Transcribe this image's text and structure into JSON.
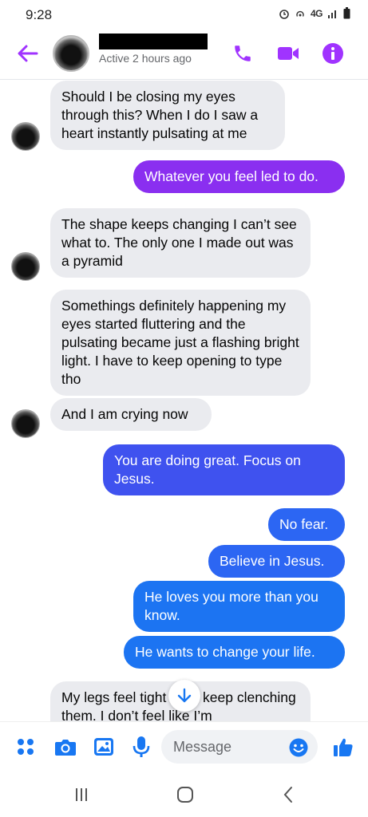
{
  "status_bar": {
    "time": "9:28",
    "network": "4G"
  },
  "header": {
    "contact_status": "Active 2 hours ago"
  },
  "messages": [
    {
      "text": "Should I be closing my eyes through this? When I do I saw a heart instantly pulsating at me"
    },
    {
      "text": "Whatever you feel led to do."
    },
    {
      "text": "The shape keeps changing I can’t see what to. The only one I made out was a pyramid"
    },
    {
      "text": "Somethings definitely happening my eyes started fluttering and the pulsating became just a flashing bright light. I have to keep opening to type tho"
    },
    {
      "text": "And I am crying now"
    },
    {
      "text": "You are doing great.  Focus on Jesus."
    },
    {
      "text": "No fear."
    },
    {
      "text": "Believe in Jesus."
    },
    {
      "text": "He loves you more than you know."
    },
    {
      "text": "He wants to change your life."
    },
    {
      "text": "My legs feel tight like I keep clenching them. I don’t feel like I’m"
    }
  ],
  "composer": {
    "placeholder": "Message"
  },
  "colors": {
    "accent": "#a033ff",
    "incoming_bubble": "#eaebef",
    "like": "#1877f2"
  },
  "icons": [
    "back-arrow-icon",
    "phone-icon",
    "video-camera-icon",
    "info-icon",
    "menu-dots-icon",
    "camera-icon",
    "gallery-icon",
    "microphone-icon",
    "emoji-icon",
    "thumbs-up-icon",
    "scroll-down-arrow-icon"
  ]
}
